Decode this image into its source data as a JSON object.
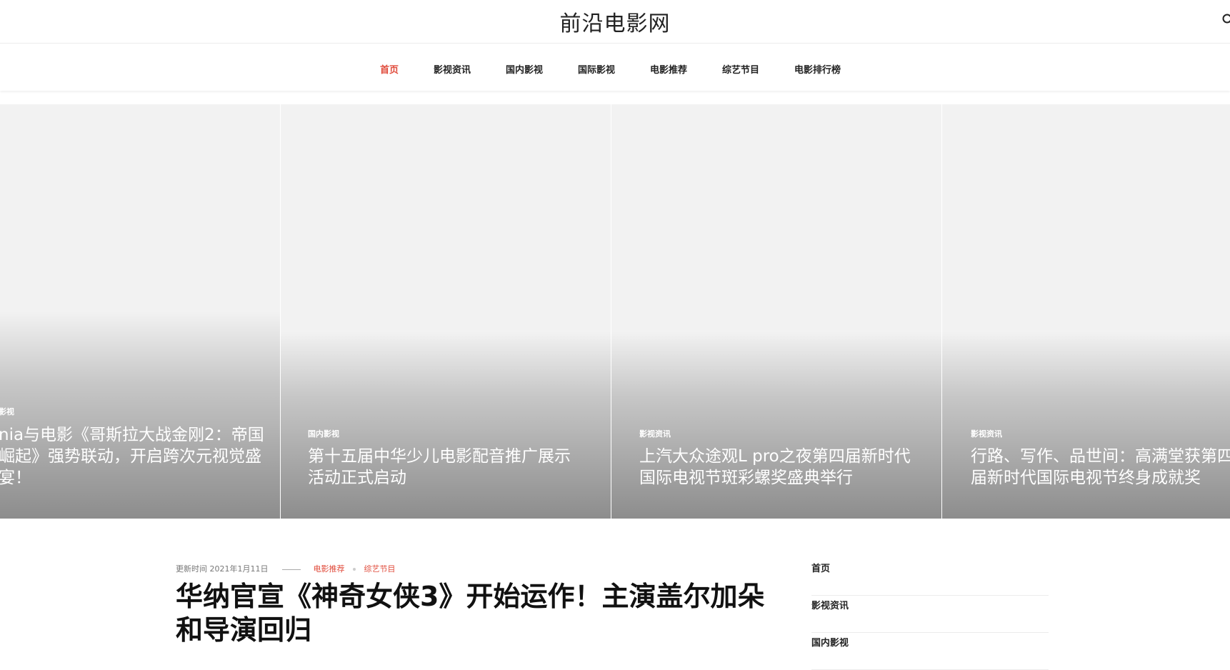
{
  "header": {
    "site_title": "前沿电影网",
    "search_icon": "search-icon"
  },
  "nav": {
    "items": [
      {
        "label": "首页",
        "active": true
      },
      {
        "label": "影视资讯"
      },
      {
        "label": "国内影视"
      },
      {
        "label": "国际影视"
      },
      {
        "label": "电影推荐"
      },
      {
        "label": "综艺节目"
      },
      {
        "label": "电影排行榜"
      }
    ]
  },
  "slider": {
    "slides": [
      {
        "category": "影视",
        "title": "nia与电影《哥斯拉大战金刚2：帝国崛起》强势联动，开启跨次元视觉盛宴！"
      },
      {
        "category": "国内影视",
        "title": "第十五届中华少儿电影配音推广展示活动正式启动"
      },
      {
        "category": "影视资讯",
        "title": "上汽大众途观L pro之夜第四届新时代国际电视节斑彩螺奖盛典举行"
      },
      {
        "category": "影视资讯",
        "title": "行路、写作、品世间：高满堂获第四届新时代国际电视节终身成就奖"
      }
    ]
  },
  "article": {
    "date": "更新时间 2021年1月11日",
    "categories": [
      "电影推荐",
      "综艺节目"
    ],
    "title": "华纳官宣《神奇女侠3》开始运作！主演盖尔加朵和导演回归"
  },
  "sidebar": {
    "items": [
      {
        "label": "首页"
      },
      {
        "label": "影视资讯"
      },
      {
        "label": "国内影视"
      }
    ]
  },
  "colors": {
    "accent": "#e04a3a",
    "text": "#222222"
  }
}
